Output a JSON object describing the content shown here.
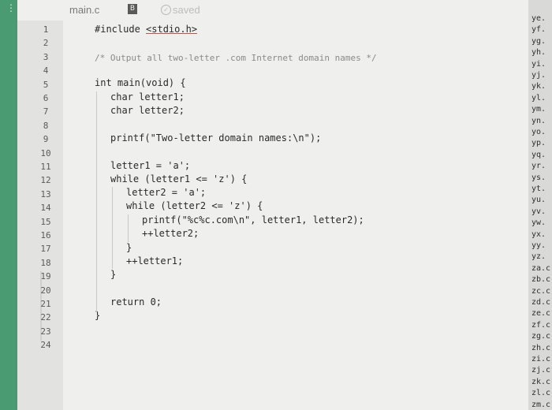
{
  "toolbar": {
    "filename": "main.c",
    "status": "saved"
  },
  "line_numbers": [
    "1",
    "2",
    "3",
    "4",
    "5",
    "6",
    "7",
    "8",
    "9",
    "10",
    "11",
    "12",
    "13",
    "14",
    "15",
    "16",
    "17",
    "18",
    "19",
    "20",
    "21",
    "22",
    "23",
    "24"
  ],
  "code": {
    "l1_pre": "#include ",
    "l1_arg": "<stdio.h>",
    "l3": "/* Output all two-letter .com Internet domain names */",
    "l5": "int main(void) {",
    "l6": "char letter1;",
    "l7": "char letter2;",
    "l9": "printf(\"Two-letter domain names:\\n\");",
    "l11": "letter1 = 'a';",
    "l12": "while (letter1 <= 'z') {",
    "l13": "letter2 = 'a';",
    "l14": "while (letter2 <= 'z') {",
    "l15": "printf(\"%c%c.com\\n\", letter1, letter2);",
    "l16": "++letter2;",
    "l17": "}",
    "l18": "++letter1;",
    "l19": "}",
    "l21": "return 0;",
    "l22": "}"
  },
  "output_lines": [
    "ye.",
    "yf.",
    "yg.",
    "yh.",
    "yi.",
    "yj.",
    "yk.",
    "yl.",
    "ym.",
    "yn.",
    "yo.",
    "yp.",
    "yq.",
    "yr.",
    "ys.",
    "yt.",
    "yu.",
    "yv.",
    "yw.",
    "yx.",
    "yy.",
    "yz.",
    "za.c",
    "zb.c",
    "zc.c",
    "zd.c",
    "ze.c",
    "zf.c",
    "zg.c",
    "zh.c",
    "zi.c",
    "zj.c",
    "zk.c",
    "zl.c",
    "zm.c"
  ]
}
